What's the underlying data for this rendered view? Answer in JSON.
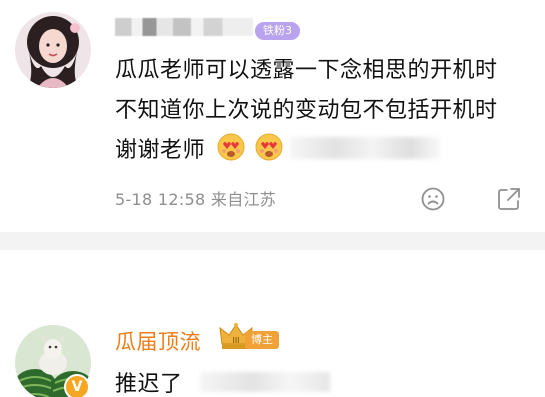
{
  "comment1": {
    "badge": "铁粉3",
    "lines": [
      "瓜瓜老师可以透露一下念相思的开机时",
      "不知道你上次说的变动包不包括开机时",
      "谢谢老师"
    ],
    "time": "5-18 12:58",
    "location": "来自江苏"
  },
  "comment2": {
    "name": "瓜届顶流",
    "badge": "博主",
    "text": "推迟了"
  }
}
